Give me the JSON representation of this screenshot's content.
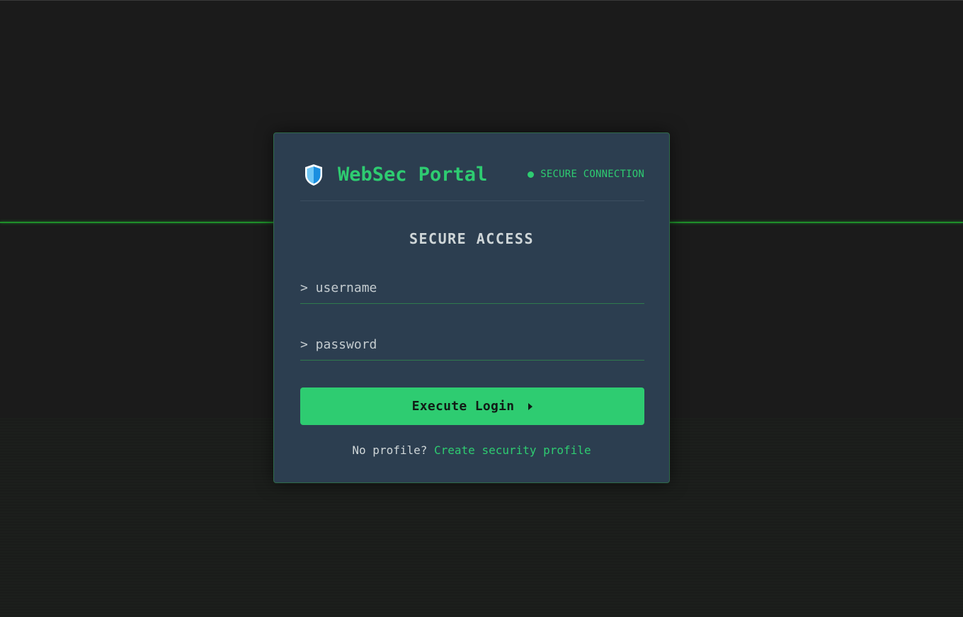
{
  "brand": {
    "title": "WebSec Portal",
    "icon": "shield-icon"
  },
  "status": {
    "text": "SECURE CONNECTION",
    "indicator": "status-dot"
  },
  "form": {
    "title": "SECURE ACCESS",
    "username": {
      "placeholder": "> username",
      "value": ""
    },
    "password": {
      "placeholder": "> password",
      "value": ""
    },
    "submit_label": "Execute Login",
    "submit_icon": "caret-right-icon"
  },
  "footer": {
    "prompt": "No profile?",
    "link_text": "Create security profile"
  },
  "colors": {
    "background": "#1b1b1b",
    "card": "#2c3e50",
    "accent": "#2ecc71",
    "scan_line": "#1f8f2a",
    "text": "#cfd6d8",
    "shield_light": "#6ec6f5",
    "shield_dark": "#1a8fe0"
  }
}
